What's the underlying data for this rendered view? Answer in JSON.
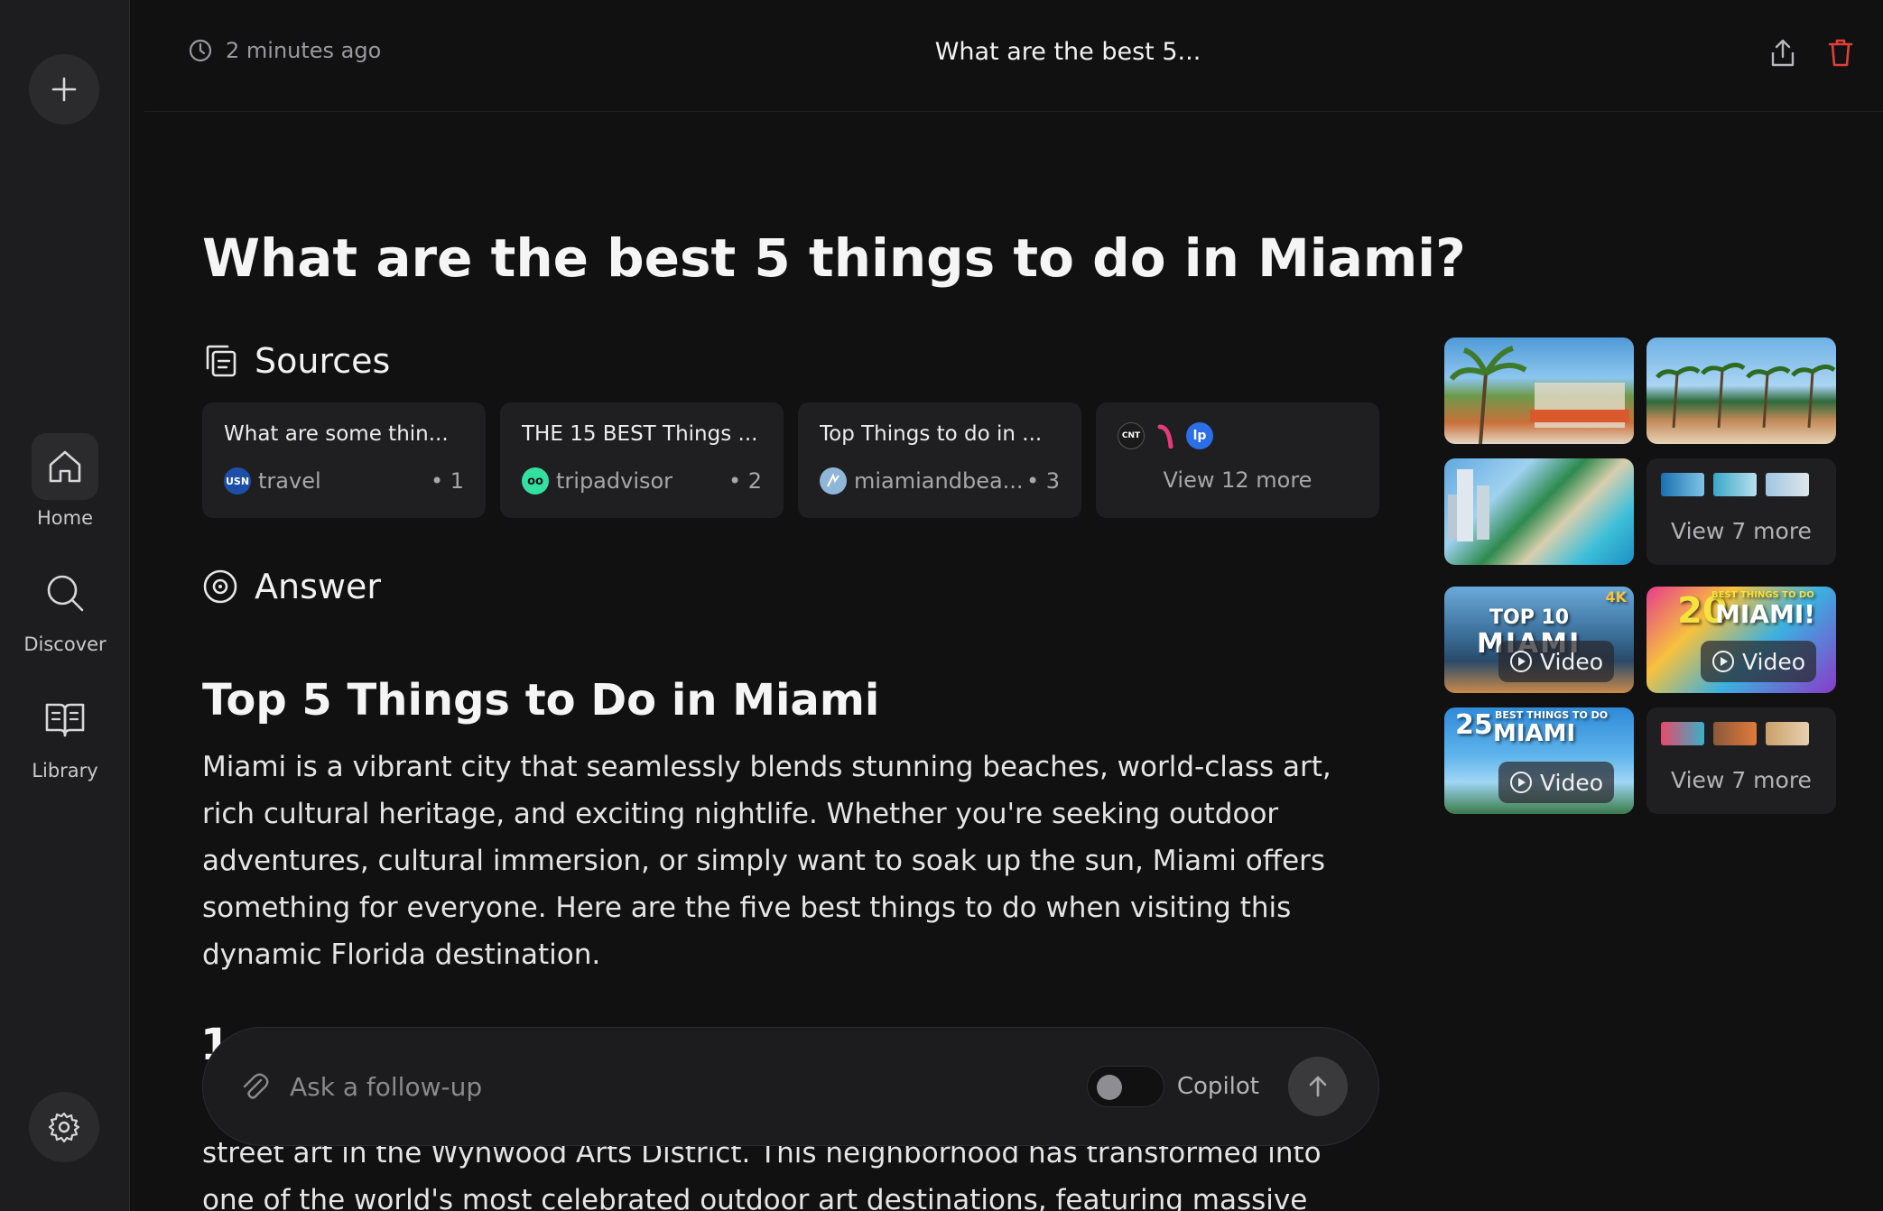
{
  "sidebar": {
    "nav": [
      {
        "label": "Home"
      },
      {
        "label": "Discover"
      },
      {
        "label": "Library"
      }
    ]
  },
  "header": {
    "time": "2 minutes ago",
    "title": "What are the best 5..."
  },
  "main": {
    "question": "What are the best 5 things to do in Miami?",
    "sources_heading": "Sources",
    "sources": [
      {
        "title": "What are some thin...",
        "site": "travel",
        "index": "• 1",
        "favicon_text": "USN",
        "favicon_color": "#1e4fa8"
      },
      {
        "title": "THE 15 BEST Things ...",
        "site": "tripadvisor",
        "index": "• 2",
        "favicon_text": "oo",
        "favicon_color": "#34e0a1"
      },
      {
        "title": "Top Things to do in ...",
        "site": "miamiandbea...",
        "index": "• 3",
        "favicon_text": "",
        "favicon_color": "#8fb6d8"
      }
    ],
    "more_sources": {
      "favicons": [
        {
          "text": "CNT",
          "color": "#1a1a1a"
        },
        {
          "text": "",
          "color": "#e23c7a"
        },
        {
          "text": "lp",
          "color": "#2a6ee8"
        }
      ],
      "label": "View 12 more"
    },
    "answer_heading": "Answer",
    "answer_title": "Top 5 Things to Do in Miami",
    "answer_paragraph": "Miami is a vibrant city that seamlessly blends stunning beaches, world-class art, rich cultural heritage, and exciting nightlife. Whether you're seeking outdoor adventures, cultural immersion, or simply want to soak up the sun, Miami offers something for everyone. Here are the five best things to do when visiting this dynamic Florida destination.",
    "partial_heading": "1",
    "answer_continued": "street art in the Wynwood Arts District. This neighborhood has transformed into one of the world's most celebrated outdoor art destinations, featuring massive"
  },
  "media": {
    "images_more": "View 7 more",
    "videos_more": "View 7 more",
    "video_badge": "Video",
    "video_overlays": [
      {
        "text": "TOP 10",
        "sub": "MIAMI",
        "corner": "4K"
      },
      {
        "text": "20",
        "sub": "MIAMI!",
        "corner": "BEST THINGS TO DO"
      },
      {
        "text": "25",
        "sub": "MIAMI",
        "corner": "BEST THINGS TO DO"
      }
    ]
  },
  "followup": {
    "placeholder": "Ask a follow-up",
    "copilot_label": "Copilot"
  }
}
